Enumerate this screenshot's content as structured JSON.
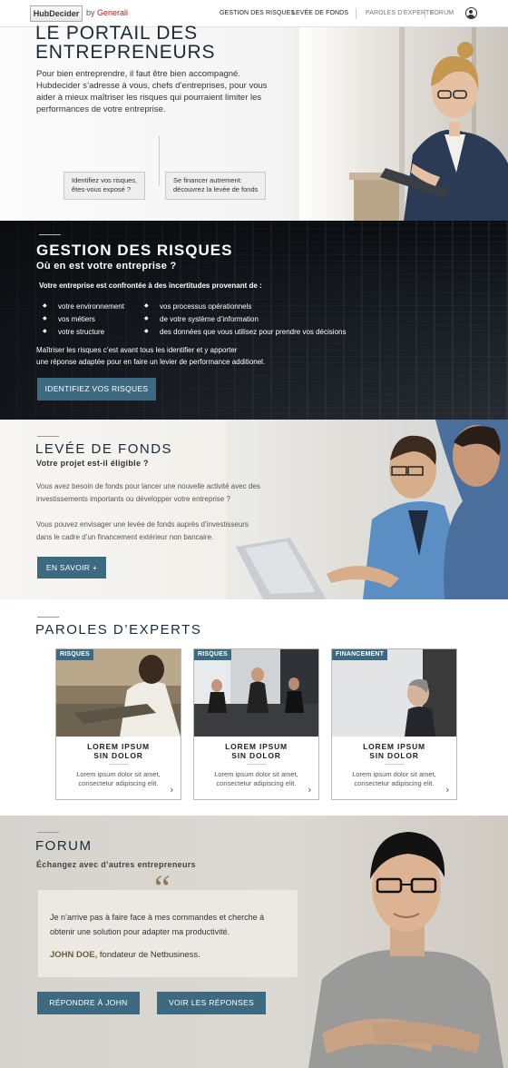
{
  "nav": {
    "logo": "HubDecider",
    "by": "by",
    "brand": "Generali",
    "links": [
      "GESTION DES RISQUES",
      "LEVÉE DE FONDS",
      "PAROLES D'EXPERTS",
      "FORUM"
    ],
    "user_icon": "user-circle-icon"
  },
  "hero": {
    "title_line1": "LE PORTAIL DES",
    "title_line2": "ENTREPRENEURS",
    "text": "Pour bien entreprendre, il faut être bien accompagné. Hubdecider s’adresse à vous, chefs d’entreprises, pour vous aider à mieux maîtriser les risques qui pourraient limiter les performances de votre entreprise.",
    "btn1_line1": "Identifiez vos risques,",
    "btn1_line2": "êtes-vous exposé ?",
    "btn2_line1": "Se financer autrement:",
    "btn2_line2": "découvrez la levée de fonds"
  },
  "gestion": {
    "title": "GESTION DES RISQUES",
    "subtitle": "Où en est votre entreprise ?",
    "intro": "Votre entreprise est confrontée à des incertitudes provenant de :",
    "bullets_left": [
      "votre environnement",
      "vos métiers",
      "votre structure"
    ],
    "bullets_right": [
      "vos processus opérationnels",
      "de votre système d’information",
      "des données que vous utilisez pour prendre vos décisions"
    ],
    "text_line1": "Maîtriser les risques c’est avant tous les identifier et y apporter",
    "text_line2": "une réponse adaptée pour en faire un levier de performance additionel.",
    "button": "IDENTIFIEZ VOS RISQUES"
  },
  "levee": {
    "title": "LEVÉE DE FONDS",
    "subtitle": "Votre projet est-il éligible ?",
    "p1_line1": "Vous avez besoin de fonds pour lancer une nouvelle activité avec des",
    "p1_line2": "investissements importants ou développer votre entreprise ?",
    "p2_line1": "Vous pouvez envisager une levée de fonds auprès d’investisseurs",
    "p2_line2": "dans le cadre d’un  financement extérieur non bancaire.",
    "button": "EN SAVOIR +"
  },
  "experts": {
    "title": "PAROLES D’EXPERTS",
    "cards": [
      {
        "tag": "RISQUES",
        "title1": "LOREM IPSUM",
        "title2": "SIN DOLOR",
        "text1": "Lorem ipsum dolor sit amet,",
        "text2": "consectetur adipiscing elit."
      },
      {
        "tag": "RISQUES",
        "title1": "LOREM IPSUM",
        "title2": "SIN DOLOR",
        "text1": "Lorem ipsum dolor sit amet,",
        "text2": "consectetur adipiscing elit."
      },
      {
        "tag": "FINANCEMENT",
        "title1": "LOREM IPSUM",
        "title2": "SIN DOLOR",
        "text1": "Lorem ipsum dolor sit amet,",
        "text2": "consectetur adipiscing elit."
      }
    ]
  },
  "forum": {
    "title": "FORUM",
    "subtitle": "Échangez avec d’autres entrepreneurs",
    "quote_line1": "Je n’arrive pas à faire face à mes commandes et cherche à",
    "quote_line2": "obtenir une solution pour adapter ma productivité.",
    "author_name": "JOHN DOE,",
    "author_role": "fondateur de Netbusiness.",
    "btn_reply": "RÉPONDRE À JOHN",
    "btn_view": "VOIR LES RÉPONSES"
  }
}
